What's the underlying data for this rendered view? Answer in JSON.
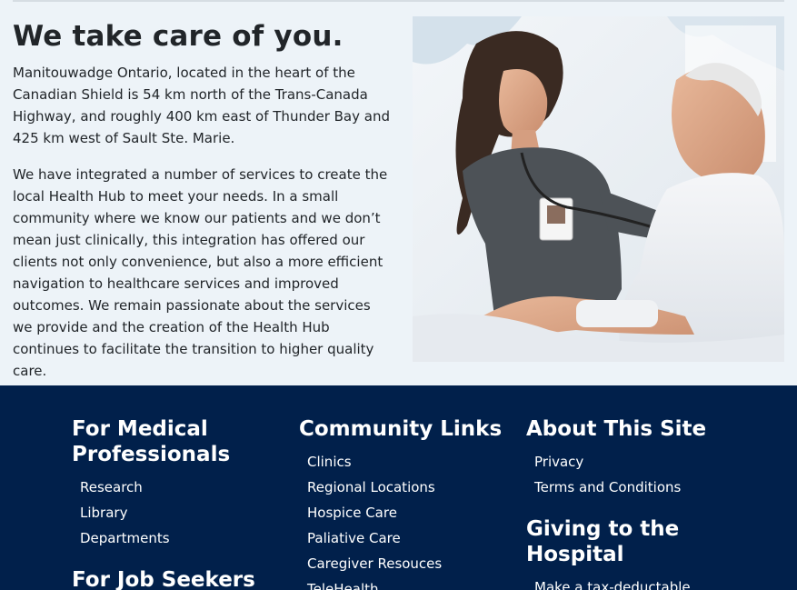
{
  "intro": {
    "title": "We take care of you.",
    "paragraph1": "Manitouwadge Ontario, located in the heart of the Canadian Shield is 54 km north of the Trans-Canada Highway, and roughly 400 km east of Thunder Bay and 425 km west of Sault Ste. Marie.",
    "paragraph2": "We have integrated a number of services to create the local Health Hub to meet your needs. In a small community where we know our patients and we don’t mean just clinically, this integration has offered our clients not only convenience, but also a more efficient navigation to healthcare services and improved outcomes. We remain passionate about the services we provide and the creation of the Health Hub continues to facilitate the transition to higher quality care."
  },
  "footer": {
    "medical": {
      "heading": "For Medical Professionals",
      "links": [
        "Research",
        "Library",
        "Departments"
      ]
    },
    "jobs": {
      "heading": "For Job Seekers"
    },
    "community": {
      "heading": "Community Links",
      "links": [
        "Clinics",
        "Regional Locations",
        "Hospice Care",
        "Paliative Care",
        "Caregiver Resouces",
        "TeleHealth"
      ]
    },
    "about": {
      "heading": "About This Site",
      "links": [
        "Privacy",
        "Terms and Conditions"
      ]
    },
    "giving": {
      "heading": "Giving to the Hospital",
      "links": [
        "Make a tax-deductable"
      ]
    }
  },
  "colors": {
    "footer_bg": "#01204b",
    "intro_bg": "#edf3f8",
    "scrub_gray": "#4d5257"
  }
}
